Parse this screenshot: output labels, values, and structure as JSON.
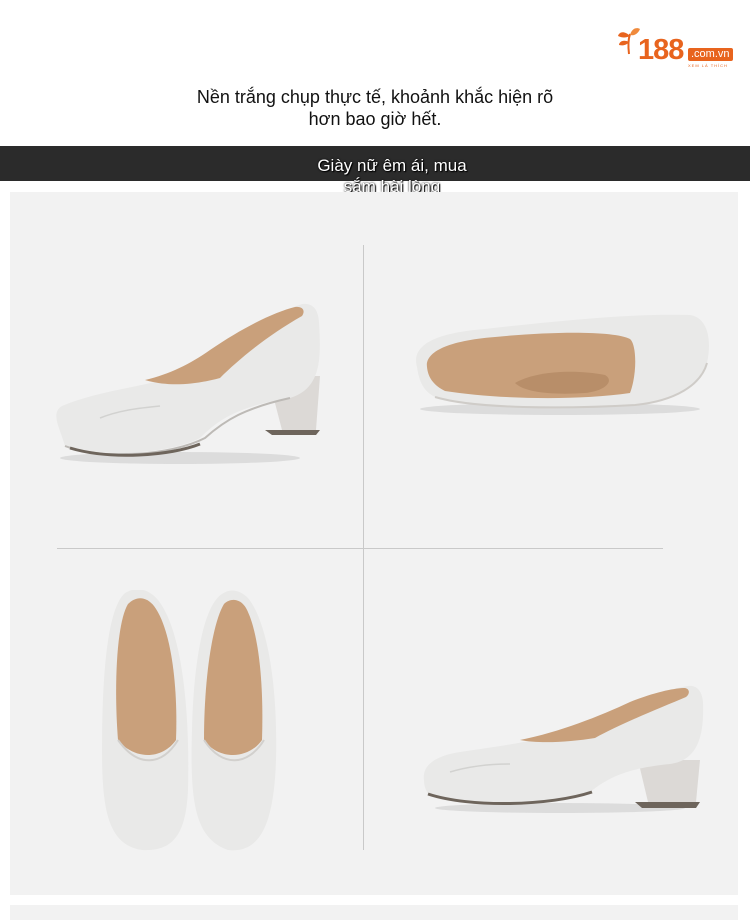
{
  "logo": {
    "number": "188",
    "domain": ".com.vn",
    "tagline": "XEM LÀ THÍCH"
  },
  "caption": {
    "line1": "Nền trắng chụp thực tế, khoảnh khắc hiện rõ",
    "line2": "hơn bao giờ hết."
  },
  "banner": {
    "line1": "Giày nữ êm ái, mua",
    "line2": "sắm hài lòng"
  },
  "colors": {
    "accent": "#e8641e",
    "band": "#2b2b2b",
    "panel": "#f2f2f2",
    "shoe": "#e9e9e8",
    "lining": "#c9a07b"
  },
  "photos": [
    {
      "view": "side-left",
      "icon": "shoe-side-photo"
    },
    {
      "view": "top-angle",
      "icon": "shoe-top-angle-photo"
    },
    {
      "view": "top-pair",
      "icon": "shoe-pair-top-photo"
    },
    {
      "view": "side-right",
      "icon": "shoe-side-photo"
    }
  ]
}
